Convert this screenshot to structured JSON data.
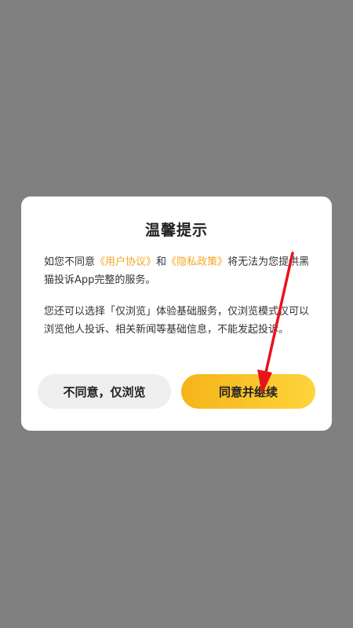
{
  "dialog": {
    "title": "温馨提示",
    "para1": {
      "prefix": "如您不同意",
      "link1": "《用户协议》",
      "middle": "和",
      "link2": "《隐私政策》",
      "suffix": "将无法为您提供黑猫投诉App完整的服务。"
    },
    "para2": "您还可以选择「仅浏览」体验基础服务，仅浏览模式仅可以浏览他人投诉、相关新闻等基础信息，不能发起投诉。",
    "decline_label": "不同意，仅浏览",
    "accept_label": "同意并继续"
  },
  "colors": {
    "link": "#f5a623",
    "accent_start": "#f5b41a",
    "accent_end": "#ffd43b",
    "arrow": "#e8121b",
    "overlay": "#808080"
  }
}
